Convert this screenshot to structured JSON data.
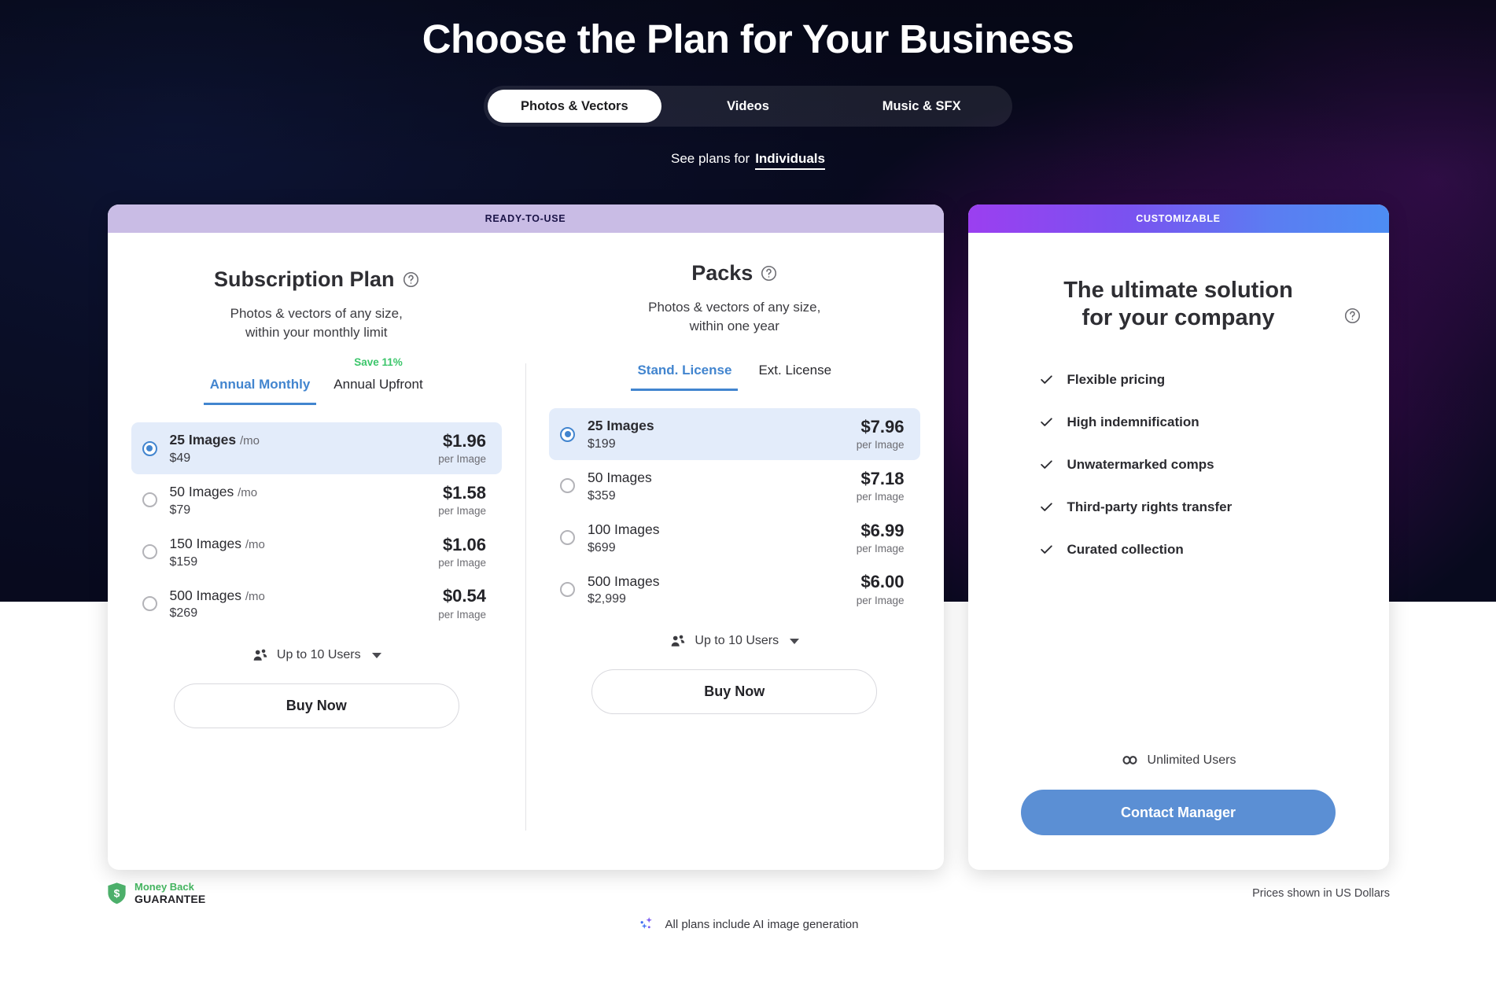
{
  "header": {
    "title": "Choose the Plan for Your Business",
    "tabs": [
      {
        "label": "Photos & Vectors",
        "active": true
      },
      {
        "label": "Videos",
        "active": false
      },
      {
        "label": "Music & SFX",
        "active": false
      }
    ],
    "see_plans_label": "See plans for",
    "see_plans_value": "Individuals"
  },
  "ready_card": {
    "ribbon": "READY-TO-USE",
    "subscription": {
      "title": "Subscription Plan",
      "help_icon": "help-circle-icon",
      "subtitle": "Photos & vectors of any size,\nwithin your monthly limit",
      "subtitle_line1": "Photos & vectors of any size,",
      "subtitle_line2": "within your monthly limit",
      "tabs": [
        {
          "label": "Annual Monthly",
          "active": true,
          "badge": ""
        },
        {
          "label": "Annual Upfront",
          "active": false,
          "badge": "Save 11%"
        }
      ],
      "options": [
        {
          "name": "25 Images",
          "period": "/mo",
          "total": "$49",
          "unit": "$1.96",
          "unit_label": "per Image",
          "selected": true
        },
        {
          "name": "50 Images",
          "period": "/mo",
          "total": "$79",
          "unit": "$1.58",
          "unit_label": "per Image",
          "selected": false
        },
        {
          "name": "150 Images",
          "period": "/mo",
          "total": "$159",
          "unit": "$1.06",
          "unit_label": "per Image",
          "selected": false
        },
        {
          "name": "500 Images",
          "period": "/mo",
          "total": "$269",
          "unit": "$0.54",
          "unit_label": "per Image",
          "selected": false
        }
      ],
      "users_label": "Up to 10 Users",
      "users_icon": "users-icon",
      "buy_label": "Buy Now"
    },
    "packs": {
      "title": "Packs",
      "help_icon": "help-circle-icon",
      "subtitle_line1": "Photos & vectors of any size,",
      "subtitle_line2": "within one year",
      "tabs": [
        {
          "label": "Stand. License",
          "active": true,
          "badge": ""
        },
        {
          "label": "Ext. License",
          "active": false,
          "badge": ""
        }
      ],
      "options": [
        {
          "name": "25 Images",
          "period": "",
          "total": "$199",
          "unit": "$7.96",
          "unit_label": "per Image",
          "selected": true
        },
        {
          "name": "50 Images",
          "period": "",
          "total": "$359",
          "unit": "$7.18",
          "unit_label": "per Image",
          "selected": false
        },
        {
          "name": "100 Images",
          "period": "",
          "total": "$699",
          "unit": "$6.99",
          "unit_label": "per Image",
          "selected": false
        },
        {
          "name": "500 Images",
          "period": "",
          "total": "$2,999",
          "unit": "$6.00",
          "unit_label": "per Image",
          "selected": false
        }
      ],
      "users_label": "Up to 10 Users",
      "users_icon": "users-icon",
      "buy_label": "Buy Now"
    }
  },
  "custom_card": {
    "ribbon": "CUSTOMIZABLE",
    "title_line1": "The ultimate solution",
    "title_line2": "for your company",
    "help_icon": "help-circle-icon",
    "features": [
      "Flexible pricing",
      "High indemnification",
      "Unwatermarked comps",
      "Third-party rights transfer",
      "Curated collection"
    ],
    "unlimited_users": "Unlimited Users",
    "unlimited_icon": "infinity-icon",
    "contact_label": "Contact Manager"
  },
  "footer": {
    "money_back_line1": "Money Back",
    "money_back_line2": "GUARANTEE",
    "money_back_icon": "shield-dollar-icon",
    "usd_note": "Prices shown in US Dollars",
    "ai_note": "All plans include AI image generation",
    "ai_icon": "sparkles-icon"
  },
  "colors": {
    "accent_blue": "#4285cf",
    "button_blue": "#5b8fd4",
    "save_green": "#3cc66b",
    "guarantee_green": "#43b35f",
    "selected_row": "#e3ecfa",
    "ribbon_ready": "#c9bce5"
  }
}
